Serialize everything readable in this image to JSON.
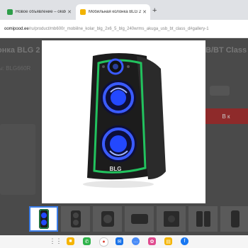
{
  "tabs": [
    {
      "title": "Новое объявление – okidoki",
      "favicon_color": "#2e9e4a",
      "close_icon": "close-icon"
    },
    {
      "title": "Мобильная колонка BLG 2x6.5\" Bl...",
      "favicon_color": "#f2b300",
      "close_icon": "close-icon",
      "active": true
    }
  ],
  "new_tab_label": "+",
  "address": {
    "host": "oomipood.ee",
    "path": "/ru/product/mb600r_mobiilne_kolar_blg_2x6_5_blg_240wrms_akuga_usb_bt_class_d#gallery-1"
  },
  "background": {
    "title_left": "онка BLG 2",
    "title_right": "B/BT Class",
    "subtitle": "ы: BLG660R",
    "button_label": "В к"
  },
  "speaker": {
    "brand": "BLG",
    "body_color": "#1c1c1c",
    "ring_color": "#22c25e",
    "driver_color": "#2a5bff"
  },
  "thumbnails": [
    {
      "name": "thumb-front-blue",
      "active": true
    },
    {
      "name": "thumb-speaker-2"
    },
    {
      "name": "thumb-speaker-3"
    },
    {
      "name": "thumb-speaker-4"
    },
    {
      "name": "thumb-speaker-5"
    },
    {
      "name": "thumb-speaker-6"
    },
    {
      "name": "thumb-speaker-7"
    }
  ],
  "taskbar": [
    {
      "name": "grid-icon",
      "color": "#666"
    },
    {
      "name": "app-yellow-icon",
      "color": "#f5b400"
    },
    {
      "name": "phone-icon",
      "color": "#2fb34a"
    },
    {
      "name": "chrome-icon",
      "color": "#db4437"
    },
    {
      "name": "messages-icon",
      "color": "#1a73e8"
    },
    {
      "name": "chat-icon",
      "color": "#4a8cf7"
    },
    {
      "name": "gallery-icon",
      "color": "#e04b8f"
    },
    {
      "name": "notes-icon",
      "color": "#f4b400"
    },
    {
      "name": "facebook-icon",
      "color": "#1877f2"
    }
  ]
}
